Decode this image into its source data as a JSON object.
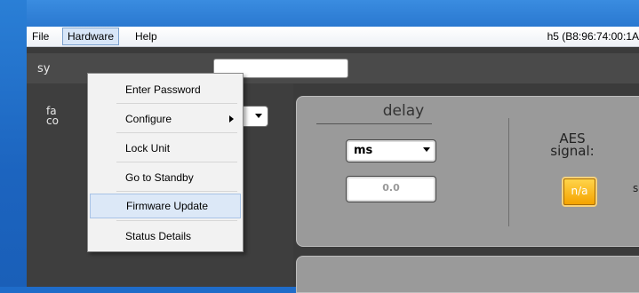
{
  "menubar": {
    "file": "File",
    "hardware": "Hardware",
    "help": "Help",
    "device_id": "h5 (B8:96:74:00:1A"
  },
  "hardware_menu": {
    "items": [
      "Enter Password",
      "Configure",
      "Lock Unit",
      "Go to Standby",
      "Firmware Update",
      "Status Details"
    ],
    "highlighted": "Firmware Update"
  },
  "system": {
    "label_partial": "sy",
    "name_value": ""
  },
  "factory": {
    "label_partial_1": "fa",
    "label_partial_2": "co"
  },
  "delay": {
    "title": "delay",
    "unit": "ms",
    "value": "0.0"
  },
  "aes": {
    "label_line1": "AES",
    "label_line2": "signal:",
    "status": "n/a",
    "cut_text": "s"
  }
}
